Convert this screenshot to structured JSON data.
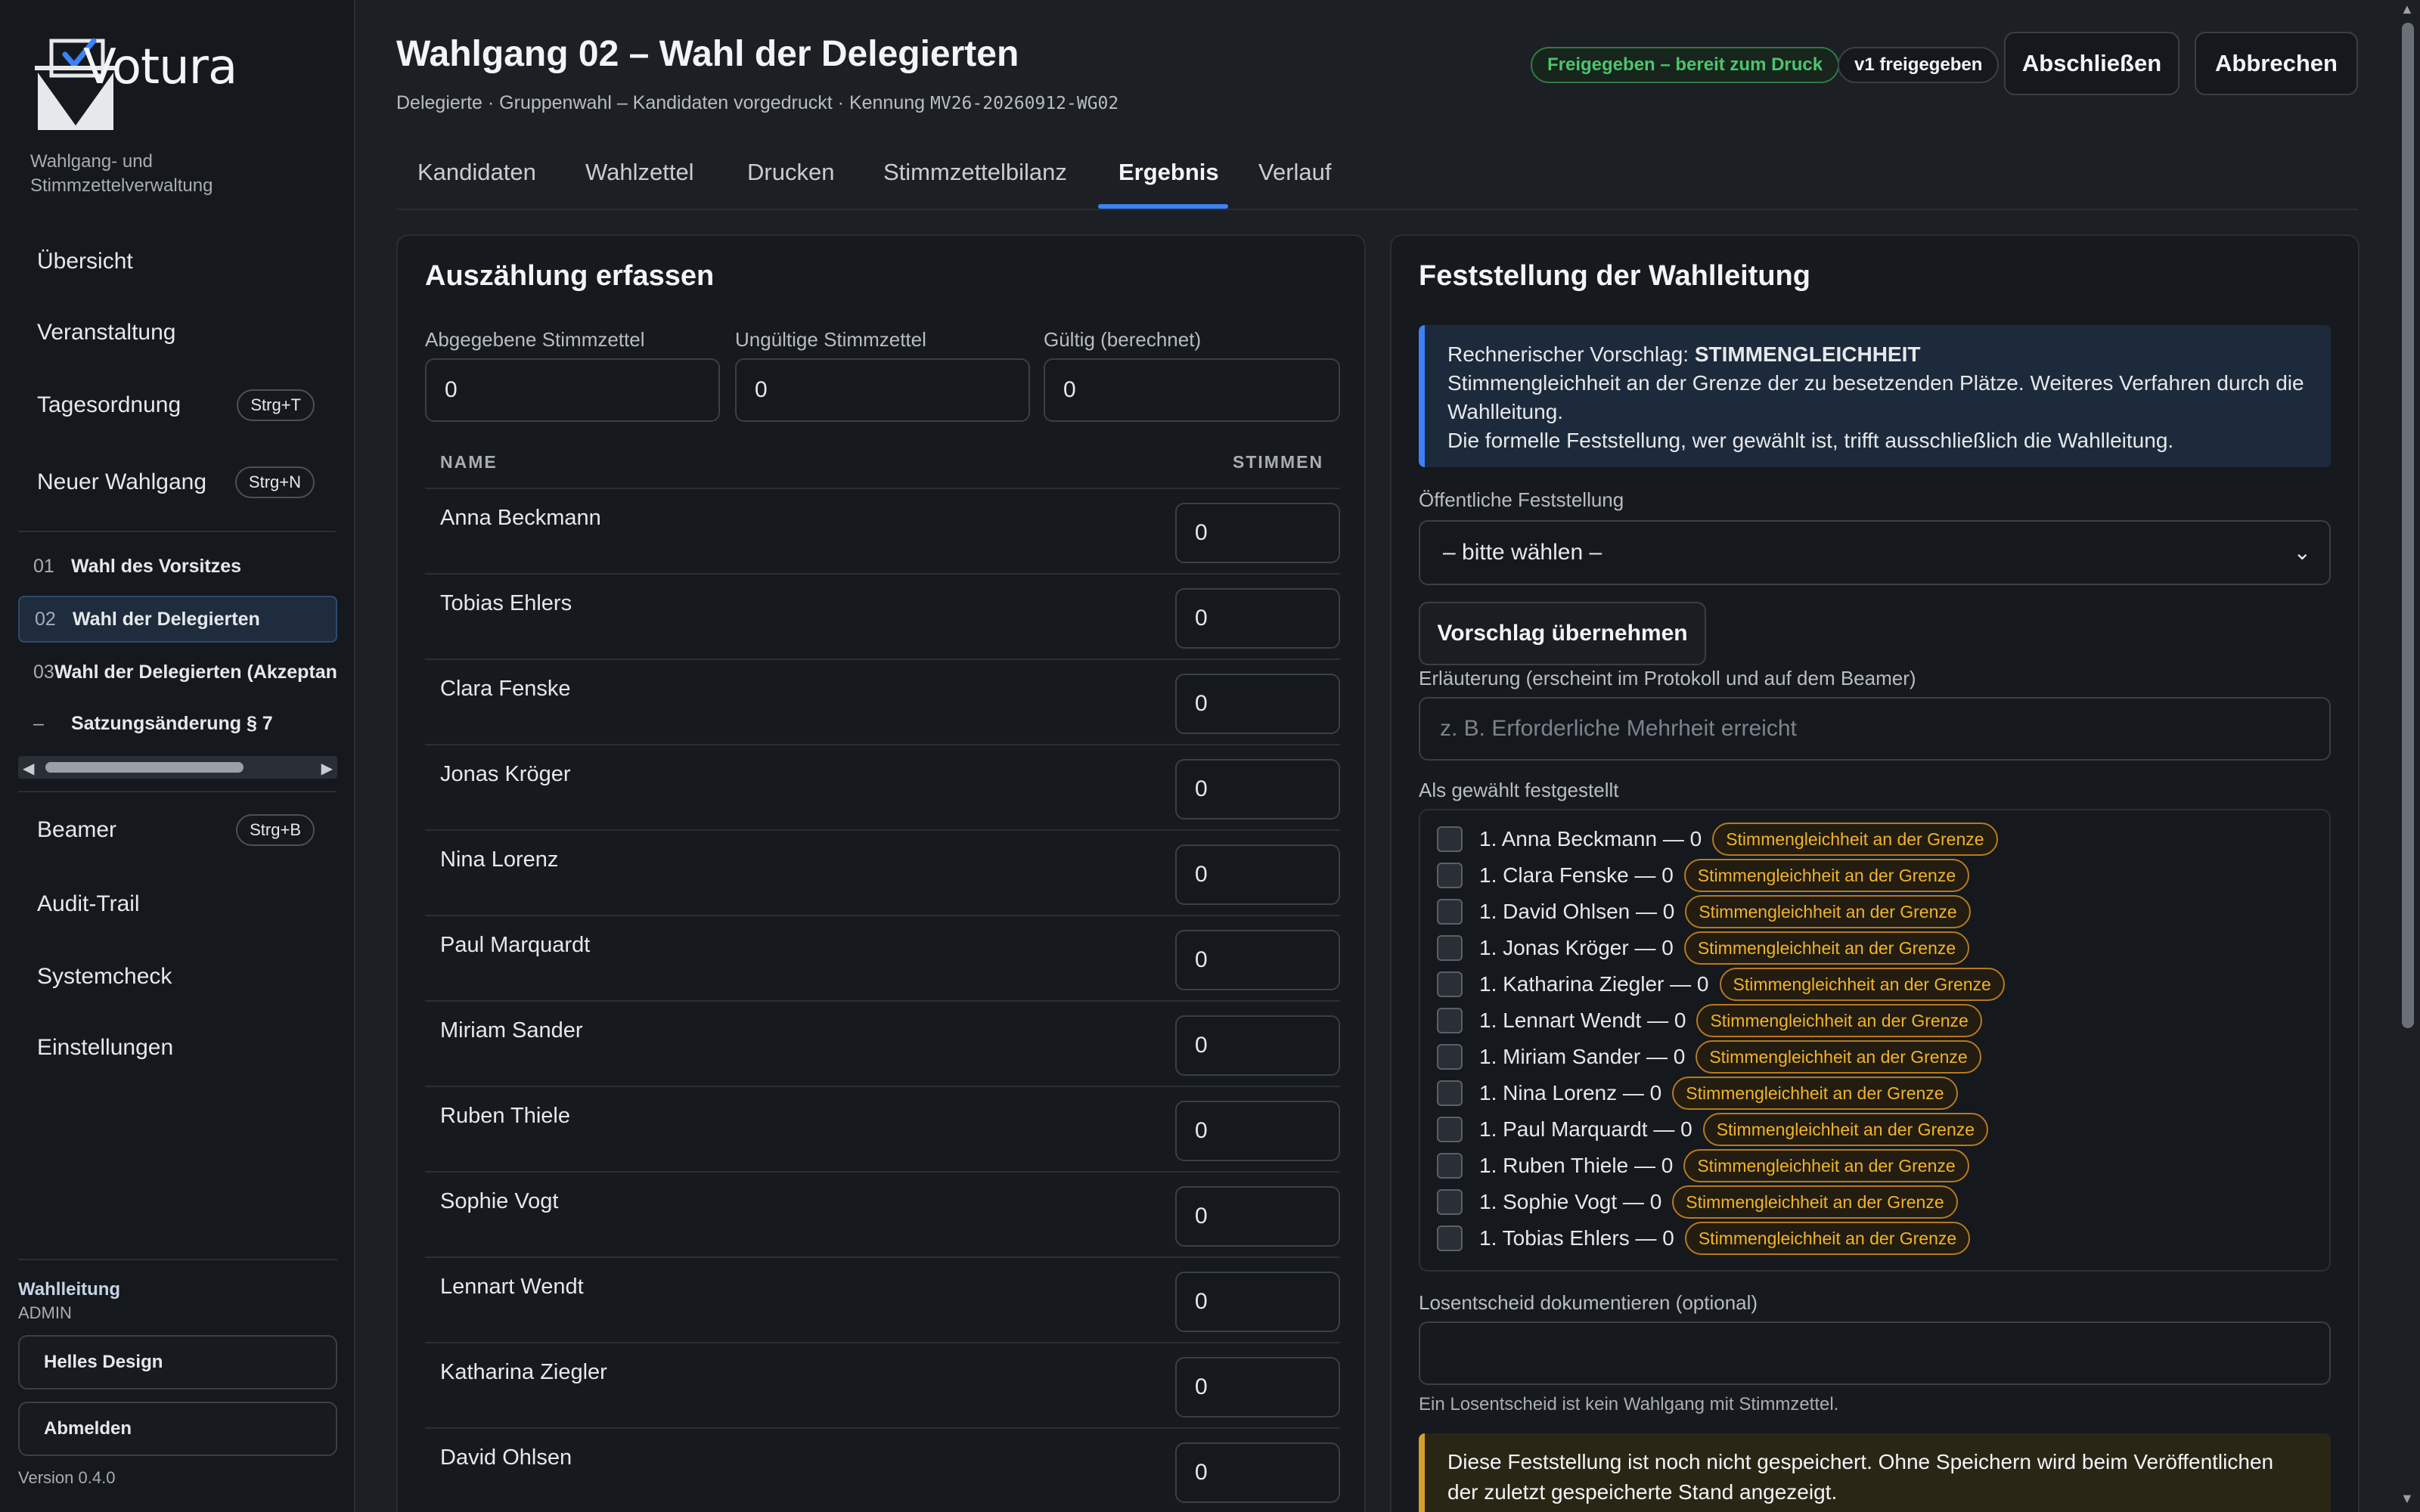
{
  "app": {
    "name": "Votura",
    "tagline": "Wahlgang- und Stimmzettelverwaltung",
    "version": "Version 0.4.0",
    "accent": "#3b82f6"
  },
  "sidebar": {
    "nav_top": [
      {
        "label": "Übersicht",
        "shortcut": ""
      },
      {
        "label": "Veranstaltung",
        "shortcut": ""
      },
      {
        "label": "Tagesordnung",
        "shortcut": "Strg+T"
      },
      {
        "label": "Neuer Wahlgang",
        "shortcut": "Strg+N"
      }
    ],
    "ballots": [
      {
        "num": "01",
        "label": "Wahl des Vorsitzes"
      },
      {
        "num": "02",
        "label": "Wahl der Delegierten"
      },
      {
        "num": "03",
        "label": "Wahl der Delegierten (Akzeptanz)"
      },
      {
        "num": "–",
        "label": "Satzungsänderung § 7"
      }
    ],
    "nav_bottom": [
      {
        "label": "Beamer",
        "shortcut": "Strg+B"
      },
      {
        "label": "Audit-Trail",
        "shortcut": ""
      },
      {
        "label": "Systemcheck",
        "shortcut": ""
      },
      {
        "label": "Einstellungen",
        "shortcut": ""
      }
    ],
    "role": "Wahlleitung",
    "user": "ADMIN",
    "theme_button": "Helles Design",
    "logout_button": "Abmelden"
  },
  "header": {
    "title": "Wahlgang 02 – Wahl der Delegierten",
    "subtitle_text": "Delegierte · Gruppenwahl – Kandidaten vorgedruckt · Kennung ",
    "code": "MV26-20260912-WG02",
    "status_badge": "Freigegeben – bereit zum Druck",
    "version_badge": "v1 freigegeben",
    "close_button": "Abschließen",
    "cancel_button": "Abbrechen"
  },
  "tabs": [
    {
      "label": "Kandidaten"
    },
    {
      "label": "Wahlzettel"
    },
    {
      "label": "Drucken"
    },
    {
      "label": "Stimmzettelbilanz"
    },
    {
      "label": "Ergebnis"
    },
    {
      "label": "Verlauf"
    }
  ],
  "count": {
    "title": "Auszählung erfassen",
    "cast_label": "Abgegebene Stimmzettel",
    "cast_value": "0",
    "invalid_label": "Ungültige Stimmzettel",
    "invalid_value": "0",
    "valid_label": "Gültig (berechnet)",
    "valid_value": "0",
    "col_name": "NAME",
    "col_votes": "STIMMEN",
    "rows": [
      {
        "name": "Anna Beckmann",
        "votes": "0"
      },
      {
        "name": "Tobias Ehlers",
        "votes": "0"
      },
      {
        "name": "Clara Fenske",
        "votes": "0"
      },
      {
        "name": "Jonas Kröger",
        "votes": "0"
      },
      {
        "name": "Nina Lorenz",
        "votes": "0"
      },
      {
        "name": "Paul Marquardt",
        "votes": "0"
      },
      {
        "name": "Miriam Sander",
        "votes": "0"
      },
      {
        "name": "Ruben Thiele",
        "votes": "0"
      },
      {
        "name": "Sophie Vogt",
        "votes": "0"
      },
      {
        "name": "Lennart Wendt",
        "votes": "0"
      },
      {
        "name": "Katharina Ziegler",
        "votes": "0"
      },
      {
        "name": "David Ohlsen",
        "votes": "0"
      }
    ]
  },
  "determination": {
    "title": "Feststellung der Wahlleitung",
    "suggestion_prefix": "Rechnerischer Vorschlag: ",
    "suggestion_value": "STIMMENGLEICHHEIT",
    "suggestion_line2": "Stimmengleichheit an der Grenze der zu besetzenden Plätze. Weiteres Verfahren durch die Wahlleitung.",
    "suggestion_line3": "Die formelle Feststellung, wer gewählt ist, trifft ausschließlich die Wahlleitung.",
    "public_label": "Öffentliche Feststellung",
    "public_selected": "– bitte wählen –",
    "accept_button": "Vorschlag übernehmen",
    "explanation_label": "Erläuterung (erscheint im Protokoll und auf dem Beamer)",
    "explanation_placeholder": "z. B. Erforderliche Mehrheit erreicht",
    "elected_label": "Als gewählt festgestellt",
    "tie_badge": "Stimmengleichheit an der Grenze",
    "elected": [
      {
        "label": "1. Anna Beckmann — 0"
      },
      {
        "label": "1. Clara Fenske — 0"
      },
      {
        "label": "1. David Ohlsen — 0"
      },
      {
        "label": "1. Jonas Kröger — 0"
      },
      {
        "label": "1. Katharina Ziegler — 0"
      },
      {
        "label": "1. Lennart Wendt — 0"
      },
      {
        "label": "1. Miriam Sander — 0"
      },
      {
        "label": "1. Nina Lorenz — 0"
      },
      {
        "label": "1. Paul Marquardt — 0"
      },
      {
        "label": "1. Ruben Thiele — 0"
      },
      {
        "label": "1. Sophie Vogt — 0"
      },
      {
        "label": "1. Tobias Ehlers — 0"
      }
    ],
    "lot_label": "Losentscheid dokumentieren (optional)",
    "lot_hint": "Ein Losentscheid ist kein Wahlgang mit Stimmzettel.",
    "warning": "Diese Feststellung ist noch nicht gespeichert. Ohne Speichern wird beim Veröffentlichen der zuletzt gespeicherte Stand angezeigt."
  }
}
